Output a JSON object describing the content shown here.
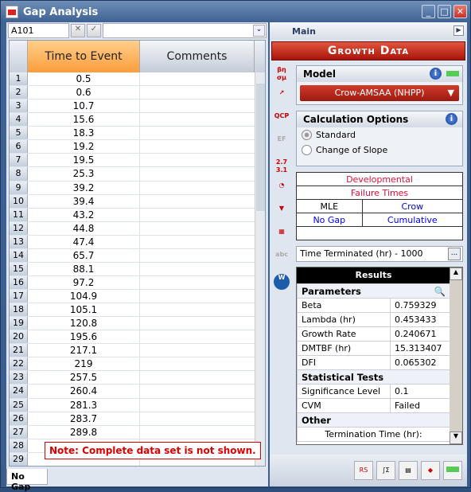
{
  "window": {
    "title": "Gap Analysis",
    "min": "_",
    "max": "□",
    "close": "✕"
  },
  "formula": {
    "cell_ref": "A101",
    "cancel": "✕",
    "accept": "✓",
    "value": "",
    "dropdown": "⌄"
  },
  "grid": {
    "columns": [
      "Time to Event",
      "Comments"
    ],
    "rows": [
      [
        "1",
        "0.5"
      ],
      [
        "2",
        "0.6"
      ],
      [
        "3",
        "10.7"
      ],
      [
        "4",
        "15.6"
      ],
      [
        "5",
        "18.3"
      ],
      [
        "6",
        "19.2"
      ],
      [
        "7",
        "19.5"
      ],
      [
        "8",
        "25.3"
      ],
      [
        "9",
        "39.2"
      ],
      [
        "10",
        "39.4"
      ],
      [
        "11",
        "43.2"
      ],
      [
        "12",
        "44.8"
      ],
      [
        "13",
        "47.4"
      ],
      [
        "14",
        "65.7"
      ],
      [
        "15",
        "88.1"
      ],
      [
        "16",
        "97.2"
      ],
      [
        "17",
        "104.9"
      ],
      [
        "18",
        "105.1"
      ],
      [
        "19",
        "120.8"
      ],
      [
        "20",
        "195.6"
      ],
      [
        "21",
        "217.1"
      ],
      [
        "22",
        "219"
      ],
      [
        "23",
        "257.5"
      ],
      [
        "24",
        "260.4"
      ],
      [
        "25",
        "281.3"
      ],
      [
        "26",
        "283.7"
      ],
      [
        "27",
        "289.8"
      ],
      [
        "28",
        ""
      ],
      [
        "29",
        ""
      ]
    ]
  },
  "note": "Note: Complete data set is not shown.",
  "sheet_tab": "No Gap",
  "right": {
    "header": "Main",
    "banner": "Growth Data",
    "side_icons": [
      "parameters-icon",
      "plot-icon",
      "qcp-icon",
      "ef-icon",
      "conversion-icon",
      "gauge-icon",
      "filter-icon",
      "transfer-icon",
      "abc-icon",
      "weibull-icon"
    ],
    "model": {
      "title": "Model",
      "value": "Crow-AMSAA (NHPP)"
    },
    "calc": {
      "title": "Calculation Options",
      "options": [
        "Standard",
        "Change of Slope"
      ],
      "selected": "Standard"
    },
    "summary": {
      "line1": "Developmental",
      "line2": "Failure Times",
      "c1": "MLE",
      "c2": "Crow",
      "c3": "No Gap",
      "c4": "Cumulative"
    },
    "termination": "Time Terminated (hr) - 1000",
    "results": {
      "title": "Results",
      "parameters_label": "Parameters",
      "parameters": [
        [
          "Beta",
          "0.759329"
        ],
        [
          "Lambda (hr)",
          "0.453433"
        ],
        [
          "Growth Rate",
          "0.240671"
        ],
        [
          "DMTBF (hr)",
          "15.313407"
        ],
        [
          "DFI",
          "0.065302"
        ]
      ],
      "tests_label": "Statistical Tests",
      "tests": [
        [
          "Significance Level",
          "0.1"
        ],
        [
          "CVM",
          "Failed"
        ]
      ],
      "other_label": "Other",
      "other_row": "Termination Time (hr):"
    }
  },
  "colors": {
    "accent_orange": "#fb9d3c",
    "banner_red": "#b8200f",
    "note_red": "#dd0000",
    "link_blue": "#0000ee"
  }
}
